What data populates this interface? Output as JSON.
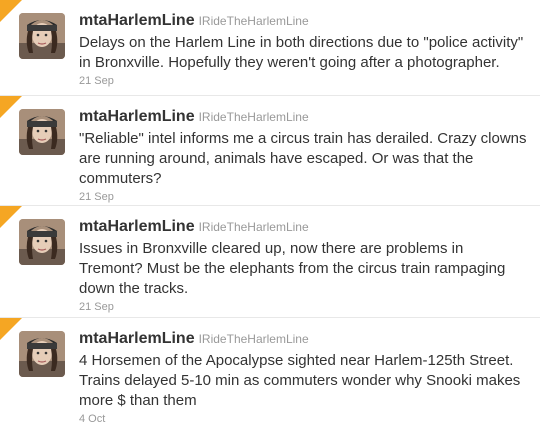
{
  "accent_color": "#f5a623",
  "tweets": [
    {
      "screen_name": "mtaHarlemLine",
      "full_name": "IRideTheHarlemLine",
      "text": "Delays on the Harlem Line in both directions due to \"police activity\" in Bronxville. Hopefully they weren't going after a photographer.",
      "time": "21 Sep",
      "favorited": true,
      "avatar_icon": "user-avatar-icon"
    },
    {
      "screen_name": "mtaHarlemLine",
      "full_name": "IRideTheHarlemLine",
      "text": "\"Reliable\" intel informs me a circus train has derailed. Crazy clowns are running around, animals have escaped. Or was that the commuters?",
      "time": "21 Sep",
      "favorited": true,
      "avatar_icon": "user-avatar-icon"
    },
    {
      "screen_name": "mtaHarlemLine",
      "full_name": "IRideTheHarlemLine",
      "text": "Issues in Bronxville cleared up, now there are problems in Tremont? Must be the elephants from the circus train rampaging down the tracks.",
      "time": "21 Sep",
      "favorited": true,
      "avatar_icon": "user-avatar-icon"
    },
    {
      "screen_name": "mtaHarlemLine",
      "full_name": "IRideTheHarlemLine",
      "text": "4 Horsemen of the Apocalypse sighted near Harlem-125th Street. Trains delayed 5-10 min as commuters wonder why Snooki makes more $ than them",
      "time": "4 Oct",
      "favorited": true,
      "avatar_icon": "user-avatar-icon"
    }
  ]
}
